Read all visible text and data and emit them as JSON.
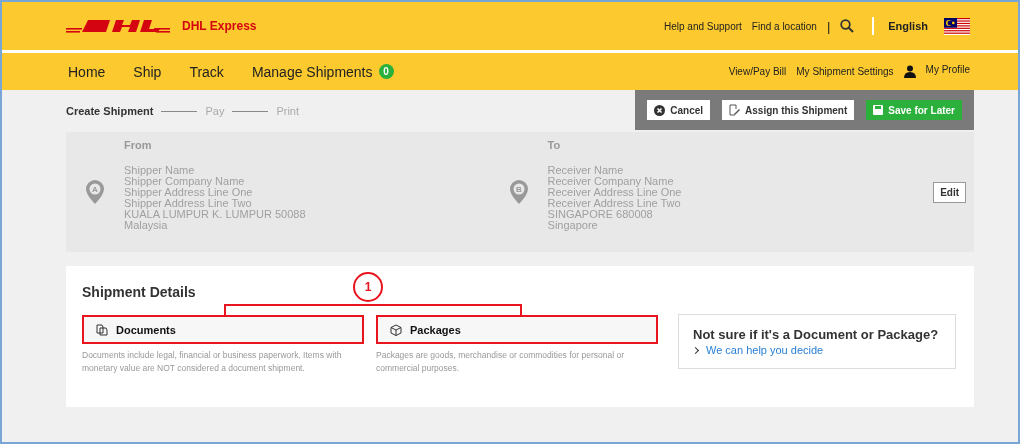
{
  "header": {
    "brand": "DHL Express",
    "links": [
      "Help and Support",
      "Find a location"
    ],
    "separator": "|",
    "language": "English"
  },
  "nav": {
    "items": [
      {
        "label": "Home"
      },
      {
        "label": "Ship"
      },
      {
        "label": "Track"
      },
      {
        "label": "Manage Shipments",
        "badge": "0"
      }
    ],
    "right": [
      "View/Pay Bill",
      "My Shipment Settings"
    ],
    "profile": "My Profile"
  },
  "steps": [
    {
      "label": "Create Shipment",
      "selected": true
    },
    {
      "label": "Pay",
      "selected": false
    },
    {
      "label": "Print",
      "selected": false
    }
  ],
  "actions": [
    {
      "kind": "cancel",
      "label": "Cancel"
    },
    {
      "kind": "assign",
      "label": "Assign this Shipment"
    },
    {
      "kind": "save",
      "label": "Save for Later"
    }
  ],
  "addresses": [
    {
      "heading": "From",
      "pin": "A",
      "lines": [
        "Shipper Name",
        "Shipper Company Name",
        "Shipper Address Line One",
        "Shipper Address Line Two",
        "KUALA LUMPUR K. LUMPUR 50088",
        "Malaysia"
      ]
    },
    {
      "heading": "To",
      "pin": "B",
      "lines": [
        "Receiver Name",
        "Receiver Company Name",
        "Receiver Address Line One",
        "Receiver Address Line Two",
        "SINGAPORE 680008",
        "Singapore"
      ]
    }
  ],
  "edit_button": "Edit",
  "details": {
    "title": "Shipment Details",
    "annotation": "1",
    "options": [
      {
        "kind": "documents",
        "label": "Documents",
        "description": "Documents include legal, financial or business paperwork. Items with monetary value are NOT considered a document shipment."
      },
      {
        "kind": "packages",
        "label": "Packages",
        "description": "Packages are goods, merchandise or commodities for personal or commercial purposes."
      }
    ],
    "help": {
      "title": "Not sure if it's a Document or Package?",
      "link": "We can help you decide"
    }
  }
}
